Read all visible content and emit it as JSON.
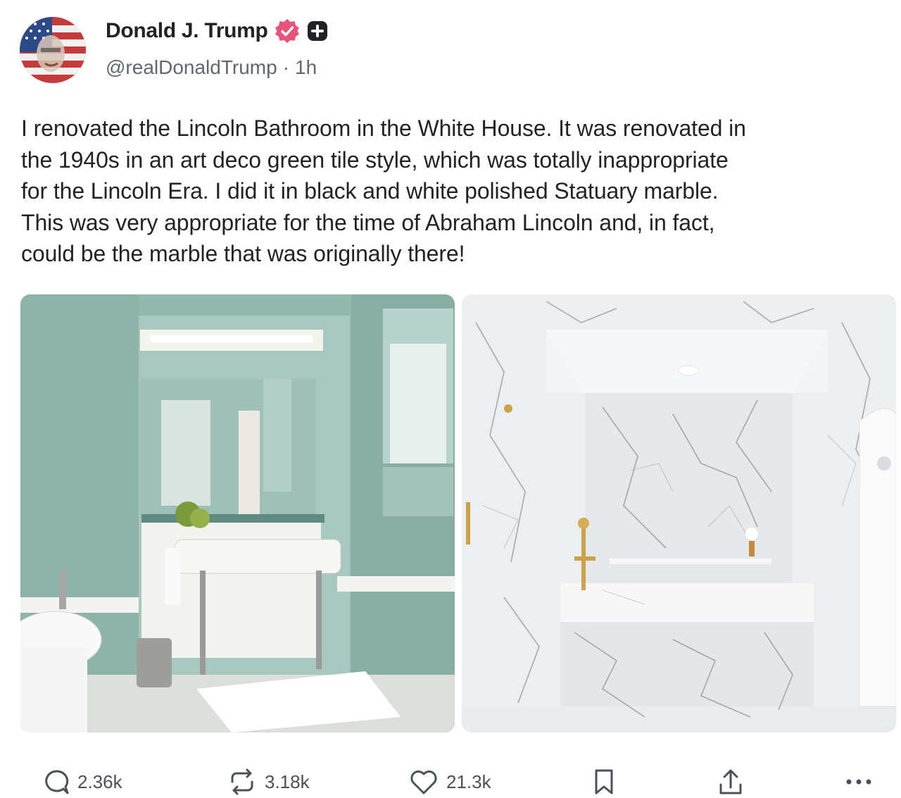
{
  "author": {
    "display_name": "Donald J. Trump",
    "handle": "@realDonaldTrump",
    "separator": "·",
    "timestamp": "1h",
    "verified_badge_color": "#e8537a",
    "avatar_icon": "avatar-flag-portrait"
  },
  "post": {
    "text": "I renovated the Lincoln Bathroom in the White House. It was renovated in\nthe 1940s in an art deco green tile style, which was totally inappropriate\nfor the Lincoln Era. I did it in black and white polished Statuary marble.\nThis was very appropriate for the time of Abraham Lincoln and, in fact,\ncould be the marble that was originally there!"
  },
  "media": [
    {
      "icon": "photo-green-tile-bathroom"
    },
    {
      "icon": "photo-marble-bathroom"
    }
  ],
  "actions": {
    "replies": "2.36k",
    "reposts": "3.18k",
    "likes": "21.3k",
    "icons": [
      "reply-icon",
      "repost-icon",
      "heart-icon",
      "bookmark-icon",
      "share-icon",
      "more-icon"
    ]
  },
  "colors": {
    "text": "#1f2328",
    "muted": "#606770",
    "action": "#4b5158",
    "tile_green": "#8fb3aa",
    "marble": "#eceef0"
  }
}
